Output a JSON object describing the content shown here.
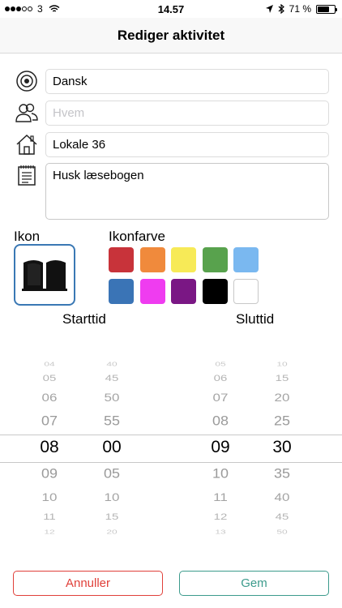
{
  "status_bar": {
    "carrier": "3",
    "time": "14.57",
    "battery": "71 %",
    "battery_level": 0.71,
    "signal_bars_filled": 3,
    "signal_bars_total": 5
  },
  "nav": {
    "title": "Rediger aktivitet"
  },
  "fields": {
    "subject": {
      "value": "Dansk",
      "icon": "target-icon"
    },
    "who": {
      "value": "",
      "placeholder": "Hvem",
      "icon": "people-icon"
    },
    "room": {
      "value": "Lokale 36",
      "icon": "house-icon"
    },
    "note": {
      "value": "Husk læsebogen",
      "icon": "notepad-icon"
    }
  },
  "icon_section": {
    "label": "Ikon",
    "selected_icon": "book-icon"
  },
  "color_section": {
    "label": "Ikonfarve",
    "colors": [
      "#c8333a",
      "#f08a3c",
      "#f7ea57",
      "#58a24d",
      "#7ab8f0",
      "#3a74b6",
      "#ef3cf0",
      "#7a1784",
      "#000000",
      "#ffffff"
    ]
  },
  "times": {
    "start_label": "Starttid",
    "end_label": "Sluttid",
    "start_hours": [
      "04",
      "05",
      "06",
      "07",
      "08",
      "09",
      "10",
      "11",
      "12"
    ],
    "start_minutes": [
      "40",
      "45",
      "50",
      "55",
      "00",
      "05",
      "10",
      "15",
      "20"
    ],
    "end_hours": [
      "05",
      "06",
      "07",
      "08",
      "09",
      "10",
      "11",
      "12",
      "13"
    ],
    "end_minutes": [
      "10",
      "15",
      "20",
      "25",
      "30",
      "35",
      "40",
      "45",
      "50"
    ],
    "selected_index": 4
  },
  "buttons": {
    "cancel": "Annuller",
    "save": "Gem"
  }
}
